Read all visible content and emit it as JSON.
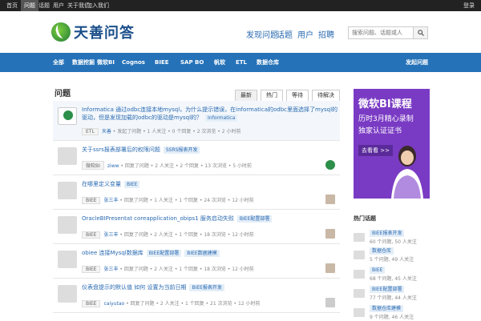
{
  "topbar": {
    "links": [
      "首页",
      "问题",
      "话题",
      "用户",
      "关于我们",
      "加入我们"
    ],
    "active_index": 1,
    "right_link": "登录"
  },
  "header": {
    "logo_text": "天善问答",
    "nav": [
      "发现问题",
      "话题",
      "用户",
      "招聘"
    ],
    "search_placeholder": "搜索问题、话题或人"
  },
  "nav": {
    "items": [
      "全部",
      "数据挖掘",
      "微软BI",
      "Cognos",
      "BIEE",
      "SAP BO",
      "帆软",
      "ETL",
      "数据仓库"
    ],
    "right_item": "发起问题"
  },
  "main": {
    "title": "问题",
    "tabs": [
      "最新",
      "热门",
      "等待",
      "待解决"
    ],
    "active_tab": 0,
    "questions": [
      {
        "title": "Informatica 通过odbc连接本地mysql，为什么提示错误，在informatica的odbc里面选择了mysql的驱动，但是发现加载的odbc的驱动是mysql的？",
        "tag": "Informatica",
        "category": "ETL",
        "user": "天善",
        "meta": "• 发起了问题 • 1 人关注 • 0 个回复 • 2 次浏览 • 2 小时前"
      },
      {
        "title": "关于ssrs报表部署后的权限问题",
        "tag": "SSRS报表开发",
        "category": "微软BI",
        "user": "ziww",
        "meta": "• 回复了问题 • 2 人关注 • 2 个回复 • 13 次浏览 • 5 小时前"
      },
      {
        "title": "在哪里定义变量",
        "tag": "BIEE",
        "category": "BIEE",
        "user": "张三丰",
        "meta": "• 回复了问题 • 1 人关注 • 1 个回复 • 24 次浏览 • 12 小时前"
      },
      {
        "title": "OracleBIPresentat coreapplication_obips1 服务启动失败",
        "tag": "BIEE配置部署",
        "category": "BIEE",
        "user": "张三丰",
        "meta": "• 回复了问题 • 2 人关注 • 1 个回复 • 18 次浏览 • 12 小时前"
      },
      {
        "title": "obiee 连接Mysql数据库",
        "tag": "BIEE配置部署",
        "tag2": "BIEE数据建模",
        "category": "BIEE",
        "user": "张三丰",
        "meta": "• 回复了问题 • 2 人关注 • 1 个回复 • 18 次浏览 • 12 小时前"
      },
      {
        "title": "仪表盘提示的默认值 如何 设置为当前日期",
        "tag": "BIEE报表开发",
        "category": "BIEE",
        "user": "caiyutao",
        "meta": "• 回复了问题 • 2 人关注 • 1 个回复 • 21 次浏览 • 12 小时前"
      }
    ]
  },
  "aside": {
    "banner_title": "微软BI课程",
    "banner_line1": "历时3月精心录制",
    "banner_line2": "独家认证证书",
    "banner_button": "去看看 >>",
    "section_title": "热门话题",
    "topics": [
      {
        "name": "BIEE报表开发",
        "stats": "60 个问题, 50 人关注"
      },
      {
        "name": "数据仓库",
        "stats": "5 个问题, 49 人关注"
      },
      {
        "name": "BIEE",
        "stats": "68 个问题, 45 人关注"
      },
      {
        "name": "BIEE配置部署",
        "stats": "77 个问题, 44 人关注"
      },
      {
        "name": "数据仓库建模",
        "stats": "9 个问题, 46 人关注"
      }
    ]
  },
  "colors": {
    "nav_bg": "#2572b8",
    "topbar_bg": "#222222",
    "link": "#2a6ab1",
    "banner_bg": "#7a3bc4"
  }
}
